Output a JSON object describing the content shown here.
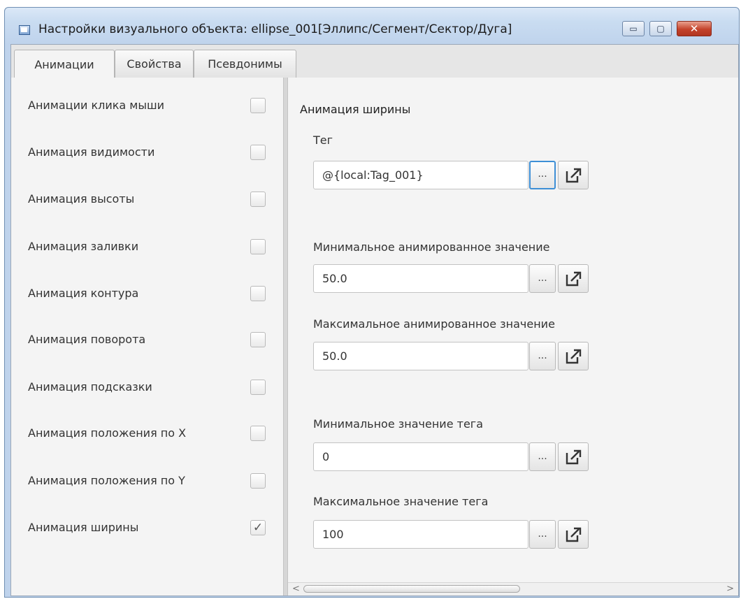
{
  "window": {
    "title": "Настройки визуального объекта: ellipse_001[Эллипс/Сегмент/Сектор/Дуга]",
    "buttons": {
      "minimize": "▭",
      "maximize": "▢",
      "close": "✕"
    }
  },
  "tabs": [
    {
      "label": "Анимации",
      "active": true
    },
    {
      "label": "Свойства",
      "active": false
    },
    {
      "label": "Псевдонимы",
      "active": false
    }
  ],
  "animations": [
    {
      "label": "Анимации клика мыши",
      "checked": false
    },
    {
      "label": "Анимация видимости",
      "checked": false
    },
    {
      "label": "Анимация высоты",
      "checked": false
    },
    {
      "label": "Анимация заливки",
      "checked": false
    },
    {
      "label": "Анимация контура",
      "checked": false
    },
    {
      "label": "Анимация поворота",
      "checked": false
    },
    {
      "label": "Анимация подсказки",
      "checked": false
    },
    {
      "label": "Анимация положения по X",
      "checked": false
    },
    {
      "label": "Анимация положения по Y",
      "checked": false
    },
    {
      "label": "Анимация ширины",
      "checked": true
    }
  ],
  "checkmark": "✓",
  "detail": {
    "title": "Анимация ширины",
    "fields": [
      {
        "label": "Тег",
        "value": "@{local:Tag_001}"
      },
      {
        "label": "Минимальное анимированное значение",
        "value": "50.0"
      },
      {
        "label": "Максимальное анимированное значение",
        "value": "50.0"
      },
      {
        "label": "Минимальное значение тега",
        "value": "0"
      },
      {
        "label": "Максимальное значение тега",
        "value": "100"
      }
    ],
    "dots_label": "...",
    "link_icon": "external-link-icon"
  },
  "scroll": {
    "left": "<",
    "right": ">"
  }
}
